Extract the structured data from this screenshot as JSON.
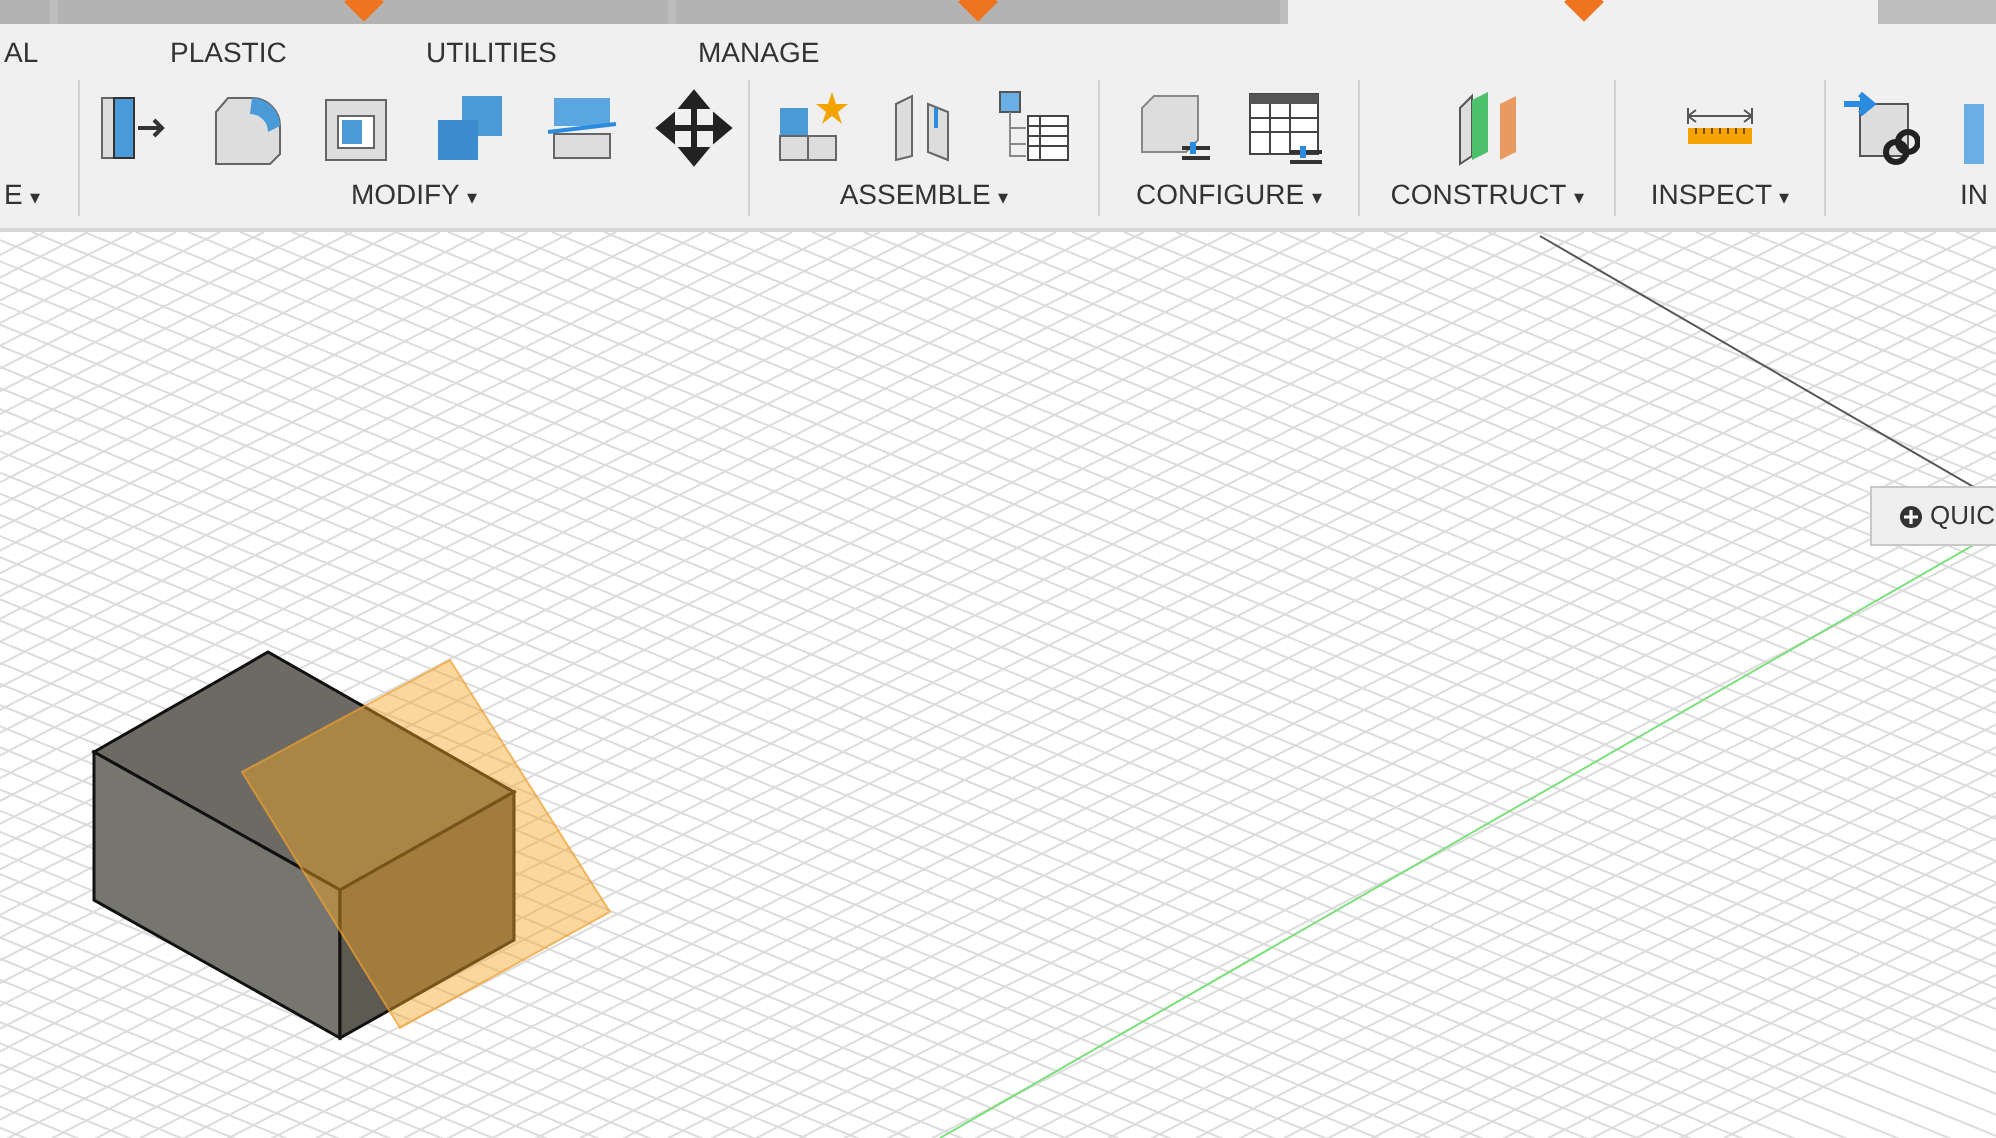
{
  "document_tabs": [
    {
      "selected": false
    },
    {
      "selected": false
    },
    {
      "selected": false
    },
    {
      "selected": true
    }
  ],
  "workspace_tabs": [
    {
      "label": "AL"
    },
    {
      "label": "PLASTIC"
    },
    {
      "label": "UTILITIES"
    },
    {
      "label": "MANAGE"
    }
  ],
  "toolbar_groups": [
    {
      "label": "E",
      "caret": "▾"
    },
    {
      "label": "MODIFY",
      "caret": "▾",
      "icons": [
        {
          "kind": "pressPull"
        },
        {
          "kind": "fillet"
        },
        {
          "kind": "shell"
        },
        {
          "kind": "combine"
        },
        {
          "kind": "split"
        },
        {
          "kind": "move"
        }
      ]
    },
    {
      "label": "ASSEMBLE",
      "caret": "▾",
      "icons": [
        {
          "kind": "newComponent"
        },
        {
          "kind": "joint"
        },
        {
          "kind": "browser"
        }
      ]
    },
    {
      "label": "CONFIGURE",
      "caret": "▾",
      "icons": [
        {
          "kind": "configCube"
        },
        {
          "kind": "configTable"
        }
      ]
    },
    {
      "label": "CONSTRUCT",
      "caret": "▾",
      "icons": [
        {
          "kind": "plane"
        }
      ]
    },
    {
      "label": "INSPECT",
      "caret": "▾",
      "icons": [
        {
          "kind": "measure"
        }
      ]
    },
    {
      "label": "IN",
      "icons": [
        {
          "kind": "insertLink"
        },
        {
          "kind": "insertCut"
        }
      ]
    }
  ],
  "quick_button": {
    "label": "QUIC"
  }
}
